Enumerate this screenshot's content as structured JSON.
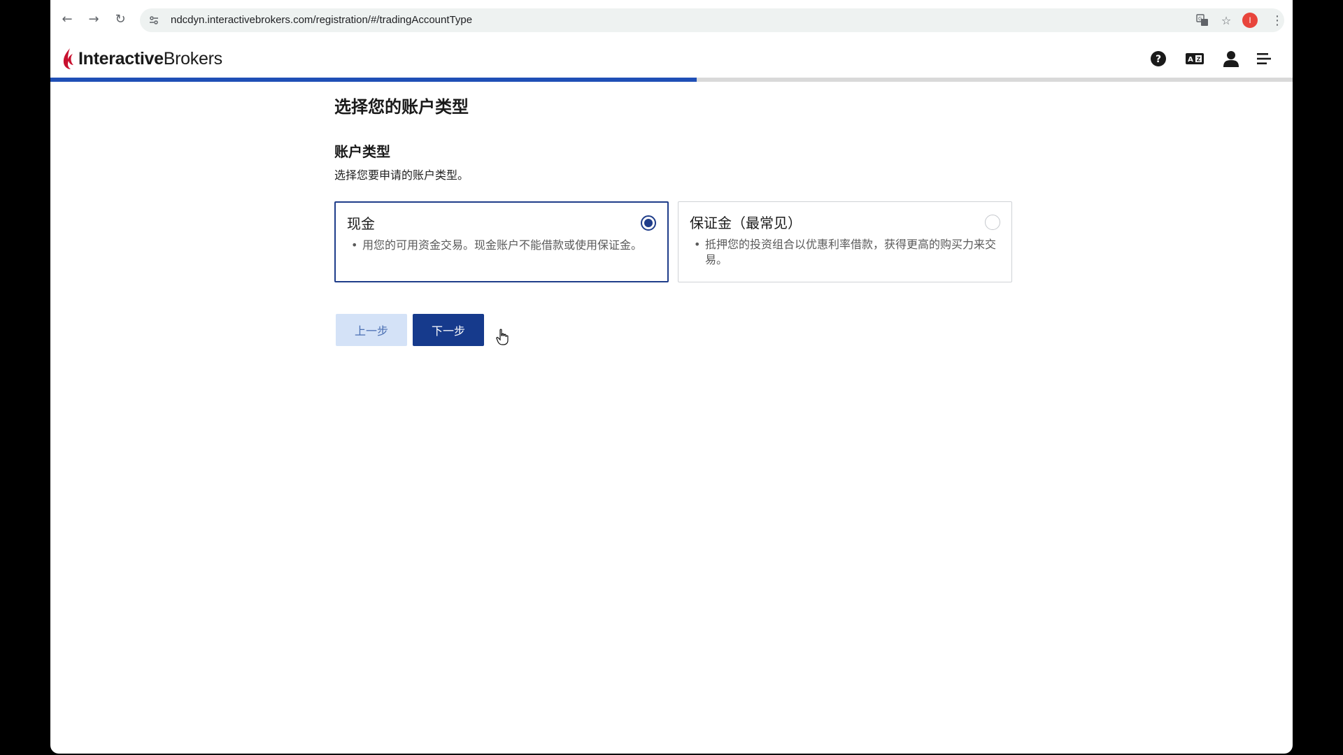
{
  "browser": {
    "url": "ndcdyn.interactivebrokers.com/registration/#/tradingAccountType",
    "profile_initial": "I",
    "icons": [
      "back-arrow-icon",
      "forward-arrow-icon",
      "reload-icon",
      "site-settings-icon",
      "translate-icon",
      "star-icon",
      "kebab-menu-icon"
    ]
  },
  "header": {
    "logo_bold": "Interactive",
    "logo_regular": "Brokers",
    "brand_color": "#c8102e",
    "icons": [
      "help-icon",
      "language-icon",
      "user-icon",
      "menu-icon"
    ]
  },
  "progress": {
    "percent": 52,
    "color": "#1f4fb6"
  },
  "page": {
    "title": "选择您的账户类型",
    "section_title": "账户类型",
    "section_desc": "选择您要申请的账户类型。"
  },
  "options": [
    {
      "title": "现金",
      "desc": "用您的可用资金交易。现金账户不能借款或使用保证金。",
      "selected": true
    },
    {
      "title": "保证金（最常见）",
      "desc": "抵押您的投资组合以优惠利率借款，获得更高的购买力来交易。",
      "selected": false
    }
  ],
  "buttons": {
    "back_label": "上一步",
    "next_label": "下一步"
  },
  "colors": {
    "primary": "#163a8c",
    "secondary_bg": "#d4e2f7"
  }
}
